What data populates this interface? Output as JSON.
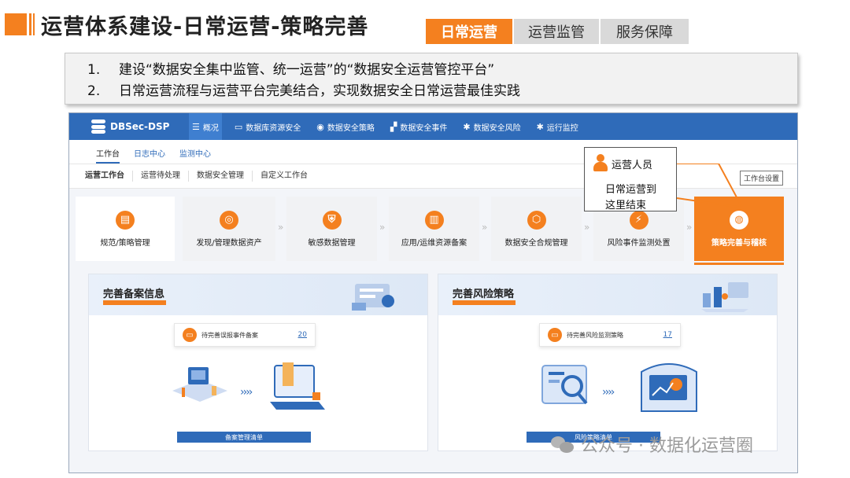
{
  "slide": {
    "title": "运营体系建设-日常运营-策略完善",
    "tabs": [
      {
        "label": "日常运营",
        "active": true
      },
      {
        "label": "运营监管",
        "active": false
      },
      {
        "label": "服务保障",
        "active": false
      }
    ],
    "bullets": [
      {
        "num": "1.",
        "text": "建设“数据安全集中监管、统一运营”的“数据安全运营管控平台”"
      },
      {
        "num": "2.",
        "text": "日常运营流程与运营平台完美结合，实现数据安全日常运营最佳实践"
      }
    ],
    "accent_color": "#f4801f"
  },
  "app": {
    "brand": "DBSec-DSP",
    "brand_color": "#2f6bb9",
    "nav": [
      {
        "icon": "database-icon",
        "label": "概况"
      },
      {
        "icon": "monitor-icon",
        "label": "数据库资源安全"
      },
      {
        "icon": "target-icon",
        "label": "数据安全策略"
      },
      {
        "icon": "grid-icon",
        "label": "数据安全事件"
      },
      {
        "icon": "gear-icon",
        "label": "数据安全风险"
      },
      {
        "icon": "gear-icon",
        "label": "运行监控"
      }
    ],
    "subnav": [
      "工作台",
      "日志中心",
      "监测中心"
    ],
    "workspace_tabs": [
      "运营工作台",
      "运营待处理",
      "数据安全管理",
      "自定义工作台"
    ],
    "workspace_settings": "工作台设置",
    "flow": [
      {
        "icon": "document-icon",
        "label": "规范/策略管理"
      },
      {
        "icon": "discover-icon",
        "label": "发现/管理数据资产"
      },
      {
        "icon": "shield-icon",
        "label": "敏感数据管理"
      },
      {
        "icon": "server-icon",
        "label": "应用/运维资源备案"
      },
      {
        "icon": "compliance-icon",
        "label": "数据安全合规管理"
      },
      {
        "icon": "alert-icon",
        "label": "风险事件监测处置"
      },
      {
        "icon": "audit-icon",
        "label": "策略完善与稽核"
      }
    ],
    "arrow": "»",
    "panels": [
      {
        "title": "完善备案信息",
        "item": "待完善误报事件备案",
        "count": "20",
        "footer": "备案管理清单"
      },
      {
        "title": "完善风险策略",
        "item": "待完善风险监测策略",
        "count": "17",
        "footer": "风险策略清单"
      }
    ],
    "flow_arrow": "››››"
  },
  "callout": {
    "role": "运营人员",
    "message_line1": "日常运营到",
    "message_line2": "这里结束"
  },
  "watermark": "公众号 · 数据化运营圈"
}
